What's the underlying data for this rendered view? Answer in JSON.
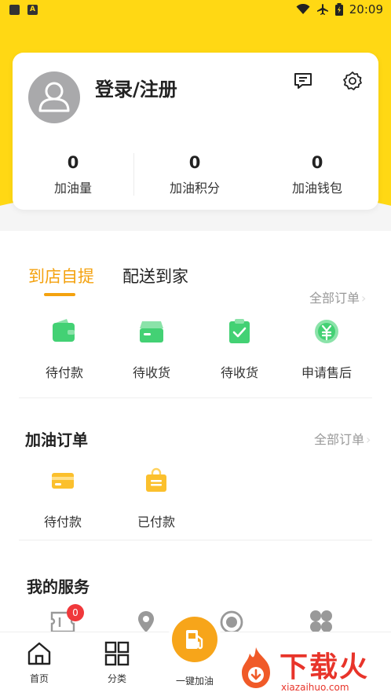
{
  "status_bar": {
    "time": "20:09",
    "icons": [
      "sim-icon",
      "a-icon",
      "wifi-icon",
      "airplane-icon",
      "battery-icon"
    ]
  },
  "user": {
    "login_label": "登录/注册"
  },
  "stats": [
    {
      "value": "0",
      "label": "加油量"
    },
    {
      "value": "0",
      "label": "加油积分"
    },
    {
      "value": "0",
      "label": "加油钱包"
    }
  ],
  "order_tabs": {
    "active": "到店自提",
    "inactive": "配送到家"
  },
  "all_orders_label": "全部订单",
  "store_orders": [
    {
      "label": "待付款",
      "icon": "wallet-icon",
      "color": "#43d174"
    },
    {
      "label": "待收货",
      "icon": "box-icon",
      "color": "#43d174"
    },
    {
      "label": "待收货",
      "icon": "clipboard-check-icon",
      "color": "#43d174"
    },
    {
      "label": "申请售后",
      "icon": "refund-icon",
      "color": "#43d174"
    }
  ],
  "fuel_orders": {
    "title": "加油订单",
    "all_label": "全部订单",
    "items": [
      {
        "label": "待付款",
        "icon": "card-icon",
        "color": "#fbc02d"
      },
      {
        "label": "已付款",
        "icon": "bag-icon",
        "color": "#fbc02d"
      }
    ]
  },
  "services": {
    "title": "我的服务",
    "badge_count": "0"
  },
  "bottom_nav": [
    {
      "label": "首页",
      "icon": "home-icon"
    },
    {
      "label": "分类",
      "icon": "grid-icon"
    },
    {
      "label": "一键加油",
      "icon": "fuel-pump-icon"
    }
  ],
  "watermark": {
    "text": "下载火",
    "url": "xiazaihuo.com"
  },
  "colors": {
    "brand_yellow": "#ffd814",
    "accent_orange": "#f4a20f",
    "green": "#43d174"
  }
}
